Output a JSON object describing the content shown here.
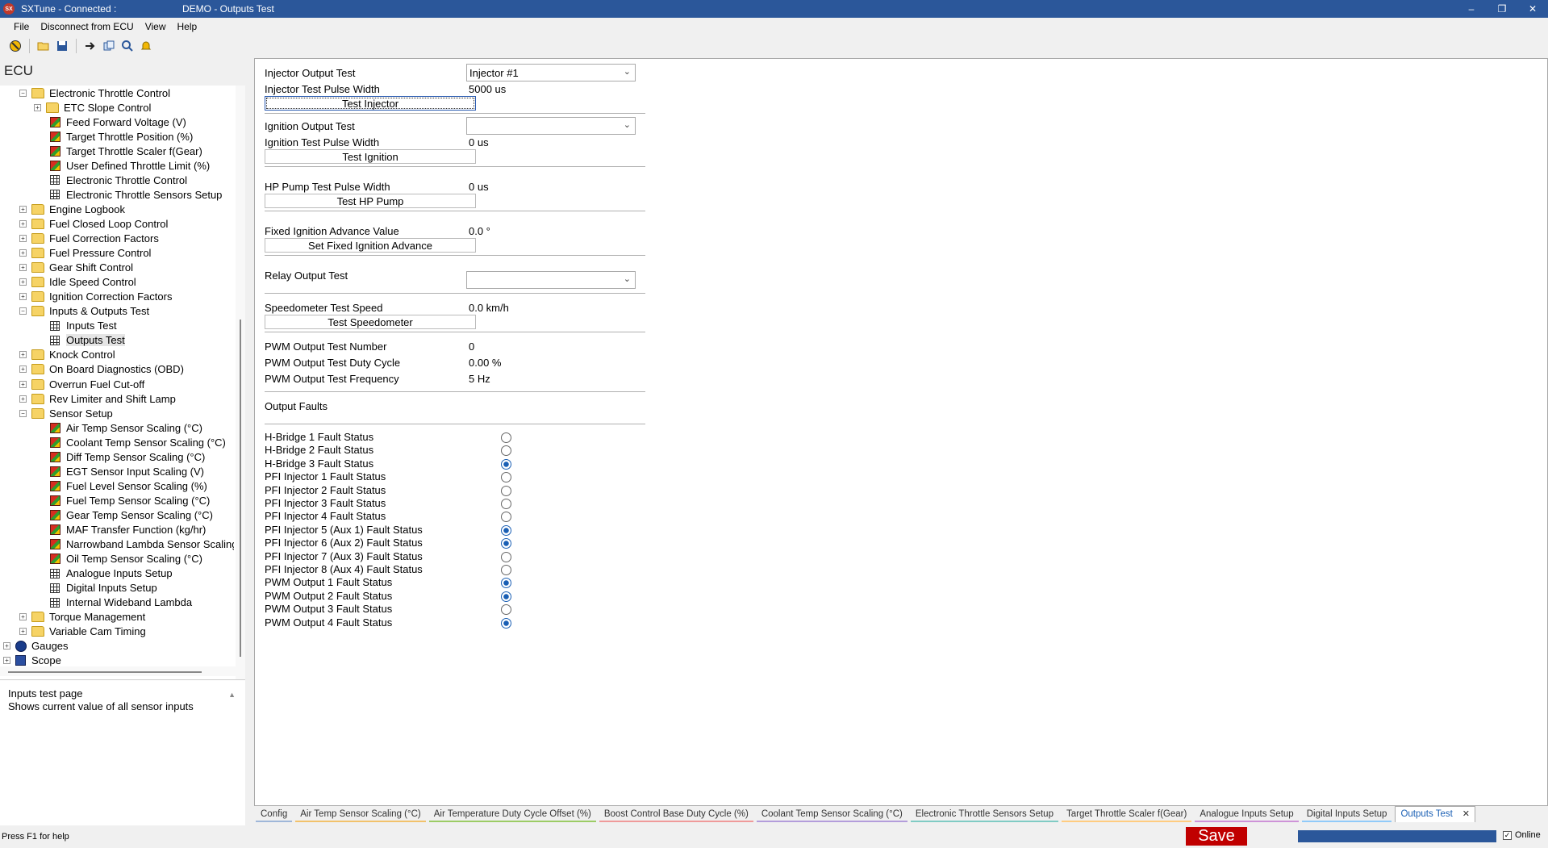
{
  "titlebar": {
    "app_name": "SXTune - Connected :",
    "window_title": "DEMO - Outputs Test",
    "minimize": "–",
    "restore": "❐",
    "close": "✕"
  },
  "menu": {
    "file": "File",
    "disconnect": "Disconnect from ECU",
    "view": "View",
    "help": "Help"
  },
  "toolbar": {
    "icons": [
      "disconnect-icon",
      "open-icon",
      "save-icon",
      "send-icon",
      "copy-icon",
      "search-icon",
      "bell-icon"
    ]
  },
  "sidebar": {
    "header": "ECU",
    "tree": [
      {
        "label": "Electronic Throttle Control",
        "level": 1,
        "icon": "folder",
        "expander": "−"
      },
      {
        "label": "ETC Slope Control",
        "level": 2,
        "icon": "folder",
        "expander": "+"
      },
      {
        "label": "Feed Forward Voltage (V)",
        "level": 3,
        "icon": "cube"
      },
      {
        "label": "Target Throttle Position (%)",
        "level": 3,
        "icon": "cube"
      },
      {
        "label": "Target Throttle Scaler f(Gear)",
        "level": 3,
        "icon": "cube"
      },
      {
        "label": "User Defined Throttle Limit (%)",
        "level": 3,
        "icon": "cube"
      },
      {
        "label": "Electronic Throttle Control",
        "level": 3,
        "icon": "grid"
      },
      {
        "label": "Electronic Throttle Sensors Setup",
        "level": 3,
        "icon": "grid"
      },
      {
        "label": "Engine Logbook",
        "level": 1,
        "icon": "folder",
        "expander": "+"
      },
      {
        "label": "Fuel Closed Loop Control",
        "level": 1,
        "icon": "folder",
        "expander": "+"
      },
      {
        "label": "Fuel Correction Factors",
        "level": 1,
        "icon": "folder",
        "expander": "+"
      },
      {
        "label": "Fuel Pressure Control",
        "level": 1,
        "icon": "folder",
        "expander": "+"
      },
      {
        "label": "Gear Shift Control",
        "level": 1,
        "icon": "folder",
        "expander": "+"
      },
      {
        "label": "Idle Speed Control",
        "level": 1,
        "icon": "folder",
        "expander": "+"
      },
      {
        "label": "Ignition Correction Factors",
        "level": 1,
        "icon": "folder",
        "expander": "+"
      },
      {
        "label": "Inputs & Outputs Test",
        "level": 1,
        "icon": "folder",
        "expander": "−"
      },
      {
        "label": "Inputs Test",
        "level": 3,
        "icon": "grid"
      },
      {
        "label": "Outputs Test",
        "level": 3,
        "icon": "grid",
        "selected": true
      },
      {
        "label": "Knock Control",
        "level": 1,
        "icon": "folder",
        "expander": "+"
      },
      {
        "label": "On Board Diagnostics (OBD)",
        "level": 1,
        "icon": "folder",
        "expander": "+"
      },
      {
        "label": "Overrun Fuel Cut-off",
        "level": 1,
        "icon": "folder",
        "expander": "+"
      },
      {
        "label": "Rev Limiter and Shift Lamp",
        "level": 1,
        "icon": "folder",
        "expander": "+"
      },
      {
        "label": "Sensor Setup",
        "level": 1,
        "icon": "folder",
        "expander": "−"
      },
      {
        "label": "Air Temp Sensor Scaling (°C)",
        "level": 3,
        "icon": "cube"
      },
      {
        "label": "Coolant Temp Sensor Scaling (°C)",
        "level": 3,
        "icon": "cube"
      },
      {
        "label": "Diff Temp Sensor Scaling (°C)",
        "level": 3,
        "icon": "cube"
      },
      {
        "label": "EGT Sensor Input Scaling (V)",
        "level": 3,
        "icon": "cube"
      },
      {
        "label": "Fuel Level Sensor Scaling (%)",
        "level": 3,
        "icon": "cube"
      },
      {
        "label": "Fuel Temp Sensor Scaling (°C)",
        "level": 3,
        "icon": "cube"
      },
      {
        "label": "Gear Temp Sensor Scaling (°C)",
        "level": 3,
        "icon": "cube"
      },
      {
        "label": "MAF Transfer Function (kg/hr)",
        "level": 3,
        "icon": "cube"
      },
      {
        "label": "Narrowband Lambda Sensor Scaling",
        "level": 3,
        "icon": "cube"
      },
      {
        "label": "Oil Temp Sensor Scaling (°C)",
        "level": 3,
        "icon": "cube"
      },
      {
        "label": "Analogue Inputs Setup",
        "level": 3,
        "icon": "grid"
      },
      {
        "label": "Digital Inputs Setup",
        "level": 3,
        "icon": "grid"
      },
      {
        "label": "Internal Wideband Lambda",
        "level": 3,
        "icon": "grid"
      },
      {
        "label": "Torque Management",
        "level": 1,
        "icon": "folder",
        "expander": "+"
      },
      {
        "label": "Variable Cam Timing",
        "level": 1,
        "icon": "folder",
        "expander": "+"
      },
      {
        "label": "Gauges",
        "level": 0,
        "icon": "gauge",
        "expander": "+"
      },
      {
        "label": "Scope",
        "level": 0,
        "icon": "scope",
        "expander": "+"
      }
    ],
    "help_title": "Inputs test page",
    "help_text": "Shows current value of all sensor inputs"
  },
  "form": {
    "injector_output_label": "Injector Output Test",
    "injector_output_value": "Injector #1",
    "injector_pw_label": "Injector Test Pulse Width",
    "injector_pw_value": "5000 us",
    "test_injector_btn": "Test Injector",
    "ignition_output_label": "Ignition Output Test",
    "ignition_output_value": "",
    "ignition_pw_label": "Ignition Test Pulse Width",
    "ignition_pw_value": "0 us",
    "test_ignition_btn": "Test Ignition",
    "hp_pump_pw_label": "HP Pump Test Pulse Width",
    "hp_pump_pw_value": "0 us",
    "test_hp_pump_btn": "Test HP Pump",
    "fixed_ign_label": "Fixed Ignition Advance Value",
    "fixed_ign_value": "0.0 °",
    "set_fixed_ign_btn": "Set Fixed Ignition Advance",
    "relay_output_label": "Relay Output Test",
    "relay_output_value": "",
    "speedo_label": "Speedometer Test Speed",
    "speedo_value": "0.0 km/h",
    "test_speedo_btn": "Test Speedometer",
    "pwm_number_label": "PWM Output Test Number",
    "pwm_number_value": "0",
    "pwm_duty_label": "PWM Output Test Duty Cycle",
    "pwm_duty_value": "0.00 %",
    "pwm_freq_label": "PWM Output Test Frequency",
    "pwm_freq_value": "5 Hz",
    "output_faults_label": "Output Faults"
  },
  "faults": [
    {
      "label": "H-Bridge 1 Fault Status",
      "on": false
    },
    {
      "label": "H-Bridge 2 Fault Status",
      "on": false
    },
    {
      "label": "H-Bridge 3 Fault Status",
      "on": true
    },
    {
      "label": "PFI Injector 1 Fault Status",
      "on": false
    },
    {
      "label": "PFI Injector 2 Fault Status",
      "on": false
    },
    {
      "label": "PFI Injector 3 Fault Status",
      "on": false
    },
    {
      "label": "PFI Injector 4 Fault Status",
      "on": false
    },
    {
      "label": "PFI Injector 5 (Aux 1) Fault Status",
      "on": true
    },
    {
      "label": "PFI Injector 6 (Aux 2) Fault Status",
      "on": true
    },
    {
      "label": "PFI Injector 7 (Aux 3) Fault Status",
      "on": false
    },
    {
      "label": "PFI Injector 8 (Aux 4) Fault Status",
      "on": false
    },
    {
      "label": "PWM Output 1 Fault Status",
      "on": true
    },
    {
      "label": "PWM Output 2 Fault Status",
      "on": true
    },
    {
      "label": "PWM Output 3 Fault Status",
      "on": false
    },
    {
      "label": "PWM Output 4 Fault Status",
      "on": true
    }
  ],
  "doc_tabs": [
    {
      "label": "Config",
      "color": "#9fb7d9"
    },
    {
      "label": "Air Temp Sensor Scaling (°C)",
      "color": "#f2c26b"
    },
    {
      "label": "Air Temperature Duty Cycle Offset (%)",
      "color": "#9ccc65"
    },
    {
      "label": "Boost Control Base Duty Cycle (%)",
      "color": "#ef9a9a"
    },
    {
      "label": "Coolant Temp Sensor Scaling (°C)",
      "color": "#b39ddb"
    },
    {
      "label": "Electronic Throttle Sensors Setup",
      "color": "#80cbc4"
    },
    {
      "label": "Target Throttle Scaler f(Gear)",
      "color": "#ffcc80"
    },
    {
      "label": "Analogue Inputs Setup",
      "color": "#ce93d8"
    },
    {
      "label": "Digital Inputs Setup",
      "color": "#90caf9"
    },
    {
      "label": "Outputs Test",
      "color": "#1a5fb4",
      "active": true
    }
  ],
  "tab_close": "✕",
  "status": {
    "help_text": "Press F1 for help",
    "save_label": "Save",
    "progress": 1.0,
    "online_label": "Online",
    "online_checked": "✓"
  }
}
